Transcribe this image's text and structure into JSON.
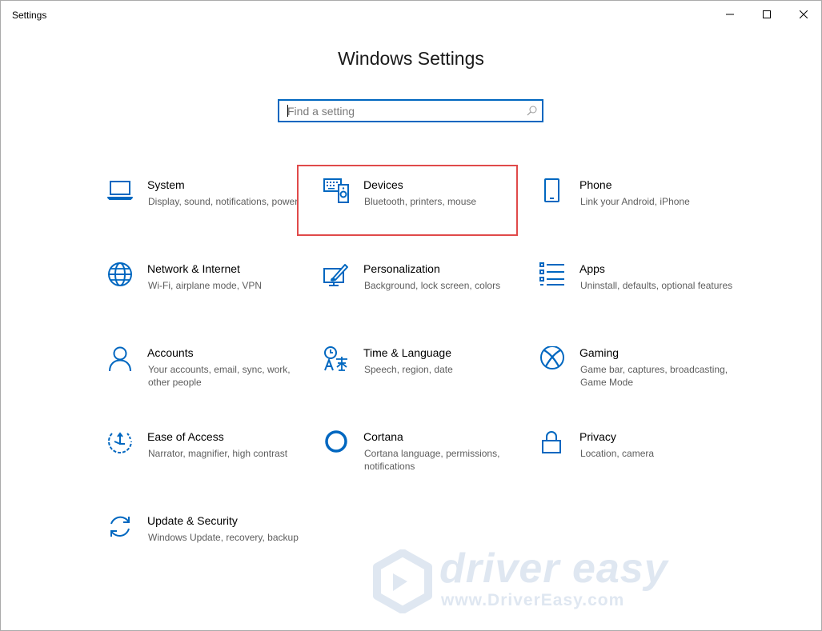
{
  "window": {
    "title": "Settings"
  },
  "page": {
    "title": "Windows Settings"
  },
  "search": {
    "value": "",
    "placeholder": "Find a setting",
    "icon": "search-icon"
  },
  "tiles": [
    {
      "id": "system",
      "name": "System",
      "desc": "Display, sound, notifications, power",
      "icon": "laptop-icon"
    },
    {
      "id": "devices",
      "name": "Devices",
      "desc": "Bluetooth, printers, mouse",
      "icon": "keyboard-speaker-icon",
      "highlighted": true
    },
    {
      "id": "phone",
      "name": "Phone",
      "desc": "Link your Android, iPhone",
      "icon": "phone-icon"
    },
    {
      "id": "network",
      "name": "Network & Internet",
      "desc": "Wi-Fi, airplane mode, VPN",
      "icon": "globe-icon"
    },
    {
      "id": "personalization",
      "name": "Personalization",
      "desc": "Background, lock screen, colors",
      "icon": "paint-brush-icon"
    },
    {
      "id": "apps",
      "name": "Apps",
      "desc": "Uninstall, defaults, optional features",
      "icon": "app-list-icon"
    },
    {
      "id": "accounts",
      "name": "Accounts",
      "desc": "Your accounts, email, sync, work, other people",
      "icon": "person-icon"
    },
    {
      "id": "time-language",
      "name": "Time & Language",
      "desc": "Speech, region, date",
      "icon": "language-icon"
    },
    {
      "id": "gaming",
      "name": "Gaming",
      "desc": "Game bar, captures, broadcasting, Game Mode",
      "icon": "xbox-icon"
    },
    {
      "id": "ease",
      "name": "Ease of Access",
      "desc": "Narrator, magnifier, high contrast",
      "icon": "ease-of-access-icon"
    },
    {
      "id": "cortana",
      "name": "Cortana",
      "desc": "Cortana language, permissions, notifications",
      "icon": "cortana-ring-icon"
    },
    {
      "id": "privacy",
      "name": "Privacy",
      "desc": "Location, camera",
      "icon": "lock-icon"
    },
    {
      "id": "update",
      "name": "Update & Security",
      "desc": "Windows Update, recovery, backup",
      "icon": "sync-arrows-icon"
    }
  ],
  "watermark": {
    "brand": "driver easy",
    "url": "www.DriverEasy.com"
  },
  "colors": {
    "accent": "#0067c0",
    "highlight": "#e04a4a",
    "description": "#5d5d5d"
  }
}
